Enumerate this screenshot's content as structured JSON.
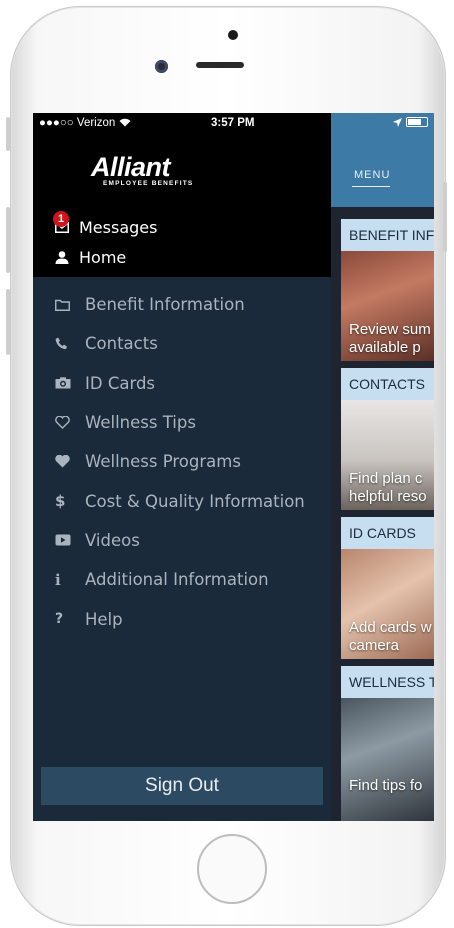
{
  "status_bar": {
    "carrier": "●●●○○ Verizon",
    "wifi": "wifi",
    "time": "3:57 PM"
  },
  "logo": {
    "name": "Alliant",
    "subtitle": "EMPLOYEE BENEFITS"
  },
  "menu_top": {
    "messages": {
      "label": "Messages",
      "badge": "1"
    },
    "home": {
      "label": "Home"
    }
  },
  "menu": {
    "items": [
      {
        "label": "Benefit Information",
        "icon": "folder-icon"
      },
      {
        "label": "Contacts",
        "icon": "phone-icon"
      },
      {
        "label": "ID Cards",
        "icon": "camera-icon"
      },
      {
        "label": "Wellness Tips",
        "icon": "heart-outline-icon"
      },
      {
        "label": "Wellness Programs",
        "icon": "heart-icon"
      },
      {
        "label": "Cost & Quality Information",
        "icon": "dollar-icon"
      },
      {
        "label": "Videos",
        "icon": "video-icon"
      },
      {
        "label": "Additional Information",
        "icon": "info-icon"
      },
      {
        "label": "Help",
        "icon": "question-icon"
      }
    ],
    "sign_out": "Sign Out"
  },
  "app_header": {
    "menu_label": "MENU"
  },
  "cards": [
    {
      "title": "BENEFIT INF",
      "line1": "Review sum",
      "line2": "available p"
    },
    {
      "title": "CONTACTS",
      "line1": "Find plan c",
      "line2": "helpful reso"
    },
    {
      "title": "ID CARDS",
      "line1": "Add cards w",
      "line2": "camera"
    },
    {
      "title": "WELLNESS T",
      "line1": "Find tips fo",
      "line2": ""
    }
  ],
  "colors": {
    "menu_bg": "#1a2a3a",
    "header_blue": "#3d7aa6",
    "card_header": "#c7def0",
    "badge": "#d0141c",
    "sign_out_bg": "#2c4a62"
  }
}
